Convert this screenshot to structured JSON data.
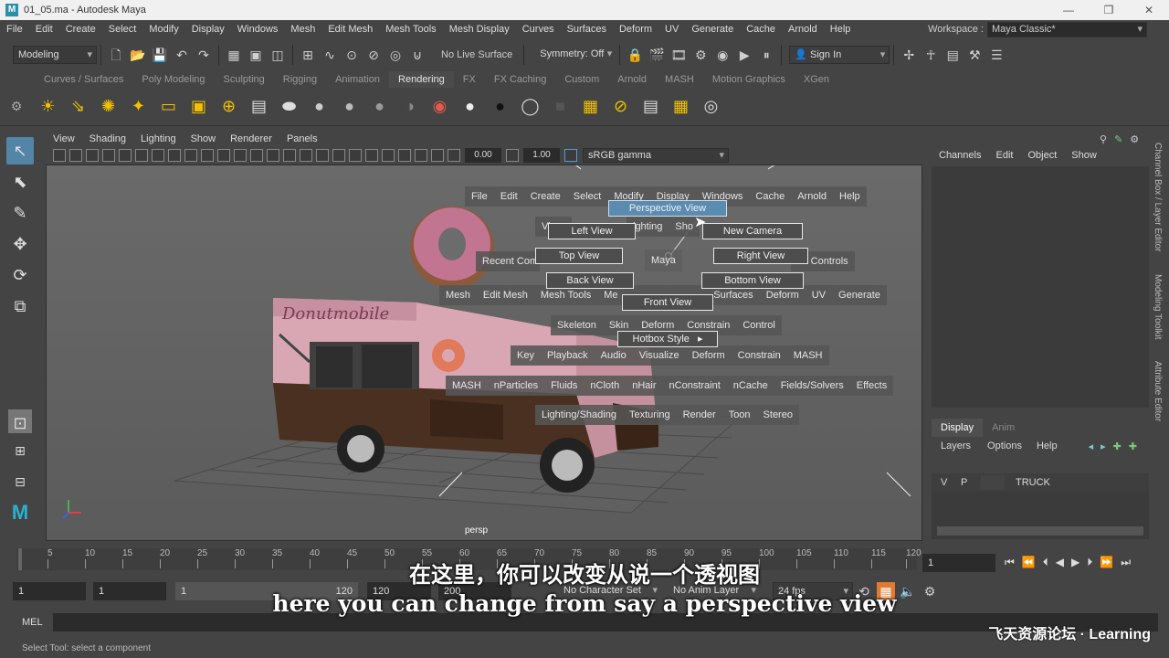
{
  "window": {
    "title": "01_05.ma - Autodesk Maya",
    "logo": "M",
    "controls": [
      "—",
      "❐",
      "✕"
    ]
  },
  "menubar": {
    "items": [
      "File",
      "Edit",
      "Create",
      "Select",
      "Modify",
      "Display",
      "Windows",
      "Mesh",
      "Edit Mesh",
      "Mesh Tools",
      "Mesh Display",
      "Curves",
      "Surfaces",
      "Deform",
      "UV",
      "Generate",
      "Cache",
      "Arnold",
      "Help"
    ],
    "workspace_label": "Workspace :",
    "workspace_value": "Maya Classic*"
  },
  "statusline": {
    "mode": "Modeling",
    "live_surface": "No Live Surface",
    "symmetry": "Symmetry: Off",
    "sign_in": "Sign In"
  },
  "shelf": {
    "tabs": [
      "Curves / Surfaces",
      "Poly Modeling",
      "Sculpting",
      "Rigging",
      "Animation",
      "Rendering",
      "FX",
      "FX Caching",
      "Custom",
      "Arnold",
      "MASH",
      "Motion Graphics",
      "XGen"
    ],
    "active_tab": "Rendering"
  },
  "viewport": {
    "menu": [
      "View",
      "Shading",
      "Lighting",
      "Show",
      "Renderer",
      "Panels"
    ],
    "near_value": "0.00",
    "far_value": "1.00",
    "color_space": "sRGB gamma",
    "camera_label": "persp",
    "truck_sign": "Donutmobile"
  },
  "hotbox": {
    "row1": [
      "File",
      "Edit",
      "Create",
      "Select",
      "Modify",
      "Display",
      "Windows",
      "Cache",
      "Arnold",
      "Help"
    ],
    "row2_left": "Vi",
    "row2_mid": "ighting",
    "row2_right": "Sho",
    "recent": "Recent Com",
    "center": "Maya",
    "controls": "ox Controls",
    "row_mesh": [
      "Mesh",
      "Edit Mesh",
      "Mesh Tools",
      "Me",
      "Surfaces",
      "Deform",
      "UV",
      "Generate"
    ],
    "row_rig": [
      "Skeleton",
      "Skin",
      "Deform",
      "Constrain",
      "Control"
    ],
    "row_anim": [
      "Key",
      "Playback",
      "Audio",
      "Visualize",
      "Deform",
      "Constrain",
      "MASH"
    ],
    "row_fx": [
      "MASH",
      "nParticles",
      "Fluids",
      "nCloth",
      "nHair",
      "nConstraint",
      "nCache",
      "Fields/Solvers",
      "Effects"
    ],
    "row_render": [
      "Lighting/Shading",
      "Texturing",
      "Render",
      "Toon",
      "Stereo"
    ],
    "views": {
      "perspective": "Perspective View",
      "left": "Left View",
      "new_camera": "New Camera",
      "top": "Top View",
      "right": "Right View",
      "back": "Back View",
      "bottom": "Bottom View",
      "front": "Front View",
      "hotbox_style": "Hotbox Style"
    }
  },
  "channelbox": {
    "menu": [
      "Channels",
      "Edit",
      "Object",
      "Show"
    ],
    "side_tabs": [
      "Channel Box / Layer Editor",
      "Modeling Toolkit",
      "Attribute Editor"
    ]
  },
  "layer_editor": {
    "tabs": [
      "Display",
      "Anim"
    ],
    "menu": [
      "Layers",
      "Options",
      "Help"
    ],
    "layer": {
      "v": "V",
      "p": "P",
      "name": "TRUCK"
    }
  },
  "timeline": {
    "ticks": [
      "5",
      "10",
      "15",
      "20",
      "25",
      "30",
      "35",
      "40",
      "45",
      "50",
      "55",
      "60",
      "65",
      "70",
      "75",
      "80",
      "85",
      "90",
      "95",
      "100",
      "105",
      "110",
      "115",
      "120"
    ],
    "current_frame": "1"
  },
  "rangebar": {
    "start": "1",
    "start2": "1",
    "range_start": "1",
    "range_end": "120",
    "end": "200",
    "character_set": "No Character Set",
    "anim_layer": "No Anim Layer",
    "fps": "24 fps"
  },
  "cmdline": {
    "label": "MEL"
  },
  "helpline": {
    "text": "Select Tool: select a component"
  },
  "subtitles": {
    "chinese": "在这里，你可以改变从说一个透视图",
    "english": "here you can change from say a perspective view"
  },
  "watermark": {
    "text": "飞天资源论坛 · Learning"
  }
}
